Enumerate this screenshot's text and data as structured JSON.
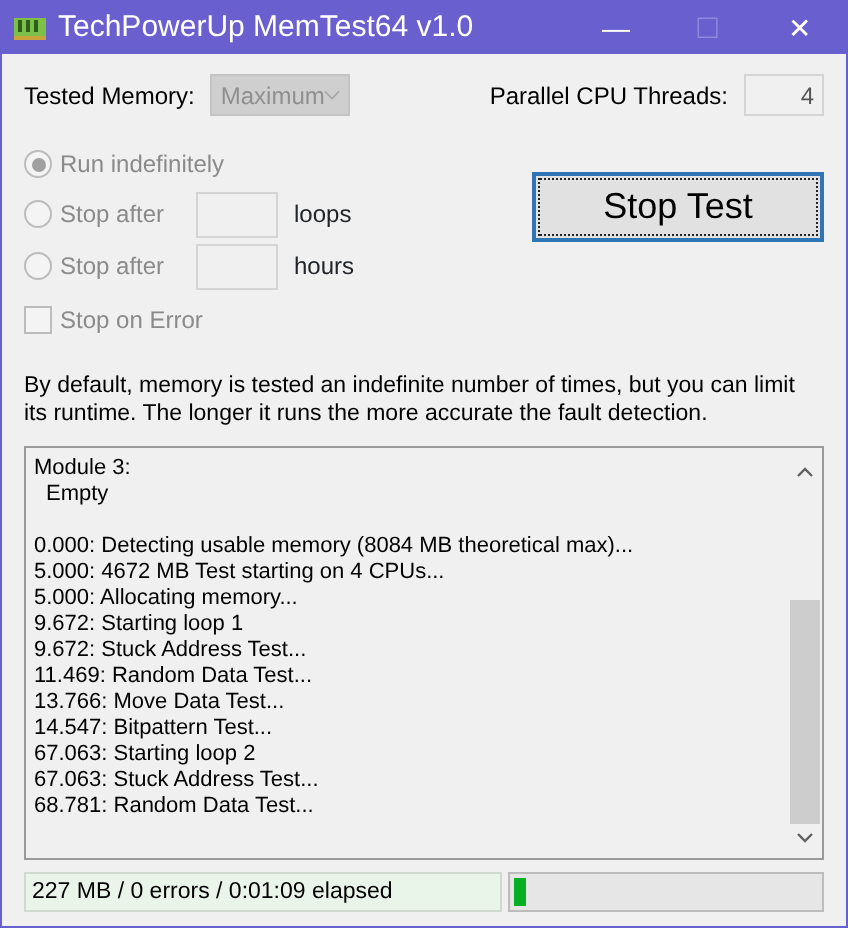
{
  "window": {
    "title": "TechPowerUp MemTest64 v1.0",
    "minimize": "—",
    "maximize": "☐",
    "close": "✕"
  },
  "tested_memory": {
    "label": "Tested Memory:",
    "value": "Maximum",
    "disabled": true
  },
  "threads": {
    "label": "Parallel CPU Threads:",
    "value": "4",
    "disabled": true
  },
  "options": [
    {
      "kind": "radio",
      "label": "Run indefinitely",
      "checked": true,
      "disabled": true
    },
    {
      "kind": "radio-field",
      "label": "Stop after",
      "unit": "loops",
      "checked": false,
      "disabled": true
    },
    {
      "kind": "radio-field",
      "label": "Stop after",
      "unit": "hours",
      "checked": false,
      "disabled": true
    },
    {
      "kind": "checkbox",
      "label": "Stop on Error",
      "checked": false,
      "disabled": true
    }
  ],
  "stop_button": "Stop Test",
  "description": "By default, memory is tested an indefinite number of times, but you can limit its runtime. The longer it runs the more accurate the fault detection.",
  "log": [
    {
      "text": "Module 3:",
      "indent": false,
      "gap_before": false
    },
    {
      "text": "Empty",
      "indent": true,
      "gap_before": false
    },
    {
      "text": "0.000: Detecting usable memory (8084 MB theoretical max)...",
      "indent": false,
      "gap_before": true
    },
    {
      "text": "5.000: 4672 MB Test starting on 4 CPUs...",
      "indent": false,
      "gap_before": false
    },
    {
      "text": "5.000: Allocating memory...",
      "indent": false,
      "gap_before": false
    },
    {
      "text": "9.672: Starting loop 1",
      "indent": false,
      "gap_before": false
    },
    {
      "text": "9.672: Stuck Address Test...",
      "indent": false,
      "gap_before": false
    },
    {
      "text": "11.469: Random Data Test...",
      "indent": false,
      "gap_before": false
    },
    {
      "text": "13.766: Move Data Test...",
      "indent": false,
      "gap_before": false
    },
    {
      "text": "14.547: Bitpattern Test...",
      "indent": false,
      "gap_before": false
    },
    {
      "text": "67.063: Starting loop 2",
      "indent": false,
      "gap_before": false
    },
    {
      "text": "67.063: Stuck Address Test...",
      "indent": false,
      "gap_before": false
    },
    {
      "text": "68.781: Random Data Test...",
      "indent": false,
      "gap_before": false
    }
  ],
  "status": {
    "text": "227 MB / 0 errors / 0:01:09 elapsed",
    "level": 0.04
  }
}
